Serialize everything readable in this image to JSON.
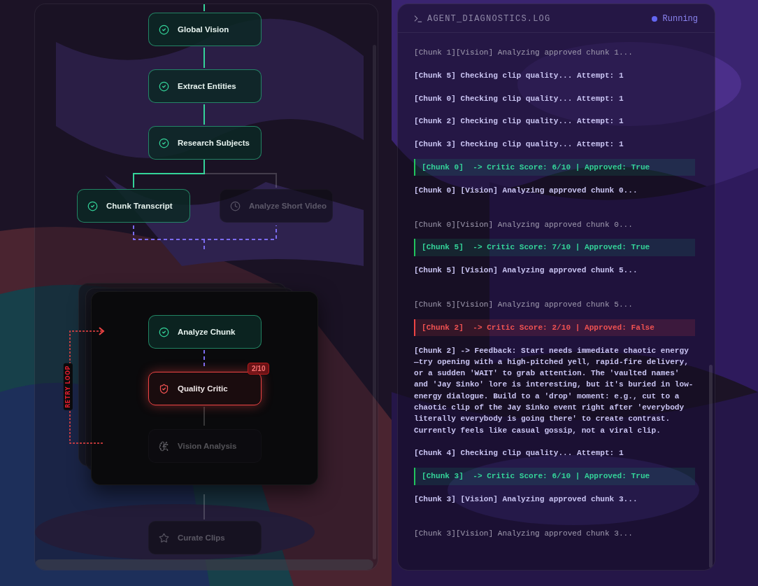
{
  "pipeline": {
    "nodes": [
      {
        "label": "Global Vision",
        "kind": "check",
        "completed": true,
        "failed": false
      },
      {
        "label": "Extract Entities",
        "kind": "check",
        "completed": true,
        "failed": false
      },
      {
        "label": "Research Subjects",
        "kind": "check",
        "completed": true,
        "failed": false
      },
      {
        "label": "Chunk Transcript",
        "kind": "check",
        "completed": true,
        "failed": false
      },
      {
        "label": "Analyze Short Video",
        "kind": "clock",
        "completed": false,
        "failed": false
      },
      {
        "label": "Analyze Chunk",
        "kind": "check",
        "completed": true,
        "failed": false
      },
      {
        "label": "Quality Critic",
        "kind": "shield",
        "completed": false,
        "failed": true,
        "badge": "2/10"
      },
      {
        "label": "Vision Analysis",
        "kind": "brain",
        "completed": false,
        "failed": false
      },
      {
        "label": "Curate Clips",
        "kind": "star",
        "completed": false,
        "failed": false
      }
    ],
    "retry_loop": {
      "label": "RETRY LOOP"
    }
  },
  "log": {
    "title": "AGENT_DIAGNOSTICS.LOG",
    "status": "Running",
    "entries": [
      {
        "kind": "vision",
        "text": "[Chunk 1][Vision] Analyzing approved chunk 1..."
      },
      {
        "kind": "info",
        "text": "[Chunk 5] Checking clip quality... Attempt: 1"
      },
      {
        "kind": "info",
        "text": "[Chunk 0] Checking clip quality... Attempt: 1"
      },
      {
        "kind": "info",
        "text": "[Chunk 2] Checking clip quality... Attempt: 1"
      },
      {
        "kind": "info",
        "text": "[Chunk 3] Checking clip quality... Attempt: 1"
      },
      {
        "kind": "approved",
        "text": "[Chunk 0]  -> Critic Score: 6/10 | Approved: True"
      },
      {
        "kind": "info",
        "text": "[Chunk 0] [Vision] Analyzing approved chunk 0..."
      },
      {
        "kind": "vision",
        "text": "[Chunk 0][Vision] Analyzing approved chunk 0..."
      },
      {
        "kind": "approved",
        "text": "[Chunk 5]  -> Critic Score: 7/10 | Approved: True"
      },
      {
        "kind": "info",
        "text": "[Chunk 5] [Vision] Analyzing approved chunk 5..."
      },
      {
        "kind": "vision",
        "text": "[Chunk 5][Vision] Analyzing approved chunk 5..."
      },
      {
        "kind": "rejected",
        "text": "[Chunk 2]  -> Critic Score: 2/10 | Approved: False"
      },
      {
        "kind": "info",
        "text": "[Chunk 2] -> Feedback: Start needs immediate chaotic energy —try opening with a high-pitched yell, rapid-fire delivery, or a sudden 'WAIT' to grab attention. The 'vaulted names' and 'Jay Sinko' lore is interesting, but it's buried in low-energy dialogue. Build to a 'drop' moment: e.g., cut to a chaotic clip of the Jay Sinko event right after 'everybody literally everybody is going there' to create contrast. Currently feels like casual gossip, not a viral clip."
      },
      {
        "kind": "info",
        "text": "[Chunk 4] Checking clip quality... Attempt: 1"
      },
      {
        "kind": "approved",
        "text": "[Chunk 3]  -> Critic Score: 6/10 | Approved: True"
      },
      {
        "kind": "info",
        "text": "[Chunk 3] [Vision] Analyzing approved chunk 3..."
      },
      {
        "kind": "vision",
        "text": "[Chunk 3][Vision] Analyzing approved chunk 3..."
      }
    ]
  }
}
